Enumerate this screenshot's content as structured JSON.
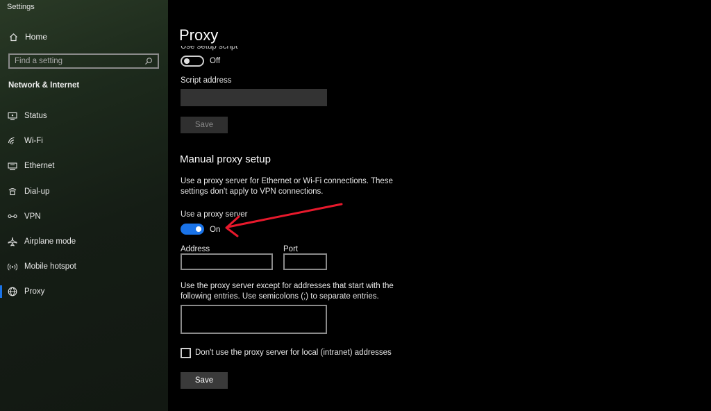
{
  "window": {
    "title": "Settings"
  },
  "sidebar": {
    "home_label": "Home",
    "search_placeholder": "Find a setting",
    "section_title": "Network & Internet",
    "items": [
      {
        "label": "Status",
        "icon": "status-icon"
      },
      {
        "label": "Wi-Fi",
        "icon": "wifi-icon"
      },
      {
        "label": "Ethernet",
        "icon": "ethernet-icon"
      },
      {
        "label": "Dial-up",
        "icon": "dialup-icon"
      },
      {
        "label": "VPN",
        "icon": "vpn-icon"
      },
      {
        "label": "Airplane mode",
        "icon": "airplane-icon"
      },
      {
        "label": "Mobile hotspot",
        "icon": "hotspot-icon"
      },
      {
        "label": "Proxy",
        "icon": "globe-icon",
        "active": true
      }
    ]
  },
  "main": {
    "page_title": "Proxy",
    "auto_setup": {
      "cut_label": "Use setup script",
      "toggle_state": "Off",
      "script_address_label": "Script address",
      "script_address_value": "",
      "save_label": "Save"
    },
    "manual_setup": {
      "heading": "Manual proxy setup",
      "description": "Use a proxy server for Ethernet or Wi-Fi connections. These settings don't apply to VPN connections.",
      "use_proxy_label": "Use a proxy server",
      "toggle_state": "On",
      "address_label": "Address",
      "address_value": "",
      "port_label": "Port",
      "port_value": "",
      "exceptions_label": "Use the proxy server except for addresses that start with the following entries. Use semicolons (;) to separate entries.",
      "exceptions_value": "",
      "local_checkbox_label": "Don't use the proxy server for local (intranet) addresses",
      "local_checkbox_checked": false,
      "save_label": "Save"
    },
    "annotation_color": "#e8192c"
  }
}
